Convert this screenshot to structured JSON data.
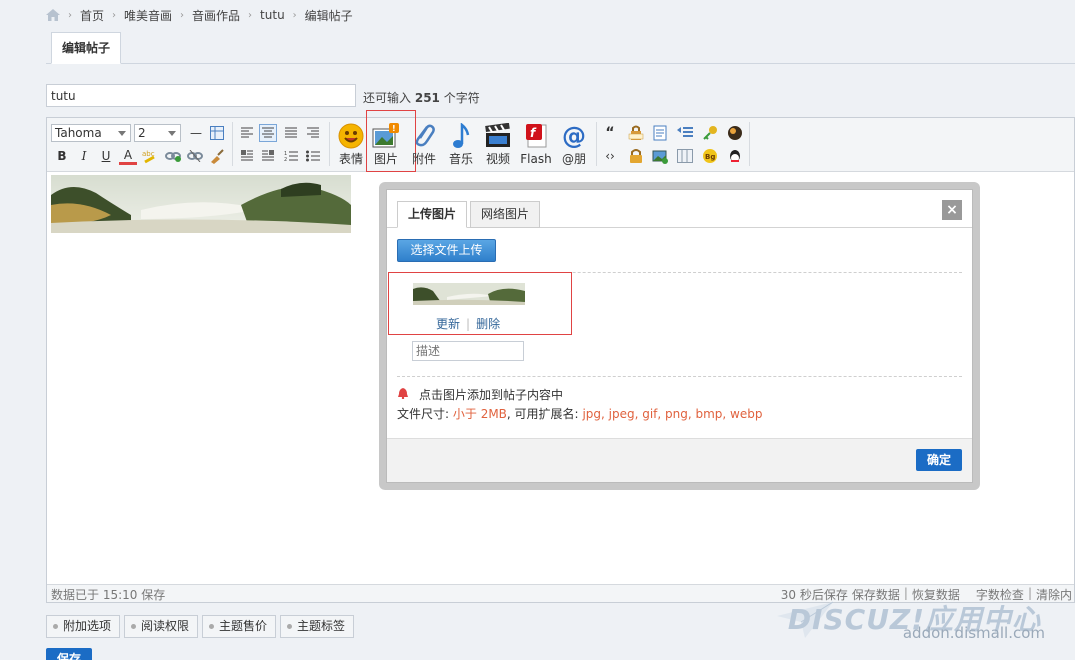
{
  "breadcrumb": [
    "首页",
    "唯美音画",
    "音画作品",
    "tutu",
    "编辑帖子"
  ],
  "tabs": {
    "active": "编辑帖子"
  },
  "title_input": {
    "value": "tutu"
  },
  "char_count": {
    "prefix": "还可输入",
    "count": "251",
    "suffix": "个字符"
  },
  "toolbar": {
    "font_family": "Tahoma",
    "font_size": "2",
    "buttons": [
      {
        "name": "emoji",
        "label": "表情"
      },
      {
        "name": "image",
        "label": "图片"
      },
      {
        "name": "attachment",
        "label": "附件"
      },
      {
        "name": "music",
        "label": "音乐"
      },
      {
        "name": "video",
        "label": "视频"
      },
      {
        "name": "flash",
        "label": "Flash"
      },
      {
        "name": "at",
        "label": "@朋"
      }
    ]
  },
  "statusbar": {
    "left": "数据已于 15:10 保存",
    "autosave": "30 秒后保存",
    "save_data": "保存数据",
    "restore_data": "恢复数据",
    "word_check": "字数检查",
    "clear": "清除内"
  },
  "dialog": {
    "tab_upload": "上传图片",
    "tab_web": "网络图片",
    "close_glyph": "×",
    "upload_button": "选择文件上传",
    "update_link": "更新",
    "delete_link": "删除",
    "desc_placeholder": "描述",
    "hint": "点击图片添加到帖子内容中",
    "file_size_label": "文件尺寸:",
    "file_size_value": "小于 2MB",
    "ext_label": ", 可用扩展名:",
    "ext_value": "jpg, jpeg, gif, png, bmp, webp",
    "confirm": "确定"
  },
  "options": [
    "附加选项",
    "阅读权限",
    "主题售价",
    "主题标签"
  ],
  "save_button": "保存",
  "watermark": {
    "logo": "DISCUZ!应用中心",
    "url": "addon.dismall.com"
  }
}
